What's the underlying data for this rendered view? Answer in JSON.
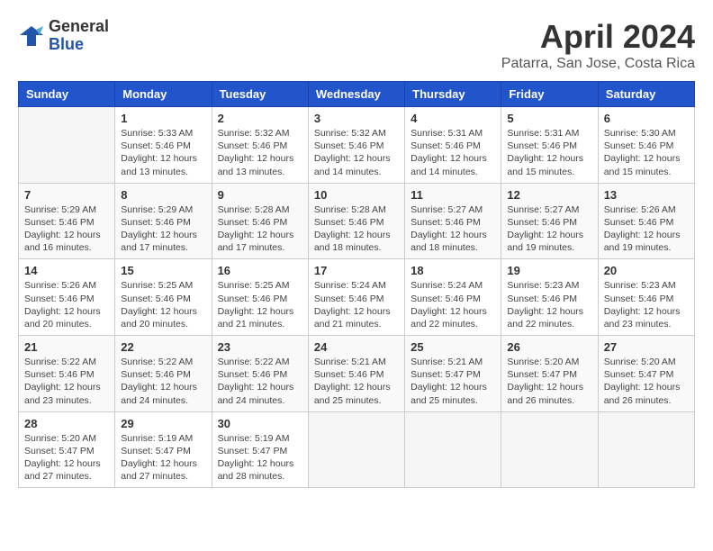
{
  "header": {
    "logo_line1": "General",
    "logo_line2": "Blue",
    "month": "April 2024",
    "location": "Patarra, San Jose, Costa Rica"
  },
  "weekdays": [
    "Sunday",
    "Monday",
    "Tuesday",
    "Wednesday",
    "Thursday",
    "Friday",
    "Saturday"
  ],
  "weeks": [
    [
      {
        "day": "",
        "info": ""
      },
      {
        "day": "1",
        "info": "Sunrise: 5:33 AM\nSunset: 5:46 PM\nDaylight: 12 hours\nand 13 minutes."
      },
      {
        "day": "2",
        "info": "Sunrise: 5:32 AM\nSunset: 5:46 PM\nDaylight: 12 hours\nand 13 minutes."
      },
      {
        "day": "3",
        "info": "Sunrise: 5:32 AM\nSunset: 5:46 PM\nDaylight: 12 hours\nand 14 minutes."
      },
      {
        "day": "4",
        "info": "Sunrise: 5:31 AM\nSunset: 5:46 PM\nDaylight: 12 hours\nand 14 minutes."
      },
      {
        "day": "5",
        "info": "Sunrise: 5:31 AM\nSunset: 5:46 PM\nDaylight: 12 hours\nand 15 minutes."
      },
      {
        "day": "6",
        "info": "Sunrise: 5:30 AM\nSunset: 5:46 PM\nDaylight: 12 hours\nand 15 minutes."
      }
    ],
    [
      {
        "day": "7",
        "info": "Sunrise: 5:29 AM\nSunset: 5:46 PM\nDaylight: 12 hours\nand 16 minutes."
      },
      {
        "day": "8",
        "info": "Sunrise: 5:29 AM\nSunset: 5:46 PM\nDaylight: 12 hours\nand 17 minutes."
      },
      {
        "day": "9",
        "info": "Sunrise: 5:28 AM\nSunset: 5:46 PM\nDaylight: 12 hours\nand 17 minutes."
      },
      {
        "day": "10",
        "info": "Sunrise: 5:28 AM\nSunset: 5:46 PM\nDaylight: 12 hours\nand 18 minutes."
      },
      {
        "day": "11",
        "info": "Sunrise: 5:27 AM\nSunset: 5:46 PM\nDaylight: 12 hours\nand 18 minutes."
      },
      {
        "day": "12",
        "info": "Sunrise: 5:27 AM\nSunset: 5:46 PM\nDaylight: 12 hours\nand 19 minutes."
      },
      {
        "day": "13",
        "info": "Sunrise: 5:26 AM\nSunset: 5:46 PM\nDaylight: 12 hours\nand 19 minutes."
      }
    ],
    [
      {
        "day": "14",
        "info": "Sunrise: 5:26 AM\nSunset: 5:46 PM\nDaylight: 12 hours\nand 20 minutes."
      },
      {
        "day": "15",
        "info": "Sunrise: 5:25 AM\nSunset: 5:46 PM\nDaylight: 12 hours\nand 20 minutes."
      },
      {
        "day": "16",
        "info": "Sunrise: 5:25 AM\nSunset: 5:46 PM\nDaylight: 12 hours\nand 21 minutes."
      },
      {
        "day": "17",
        "info": "Sunrise: 5:24 AM\nSunset: 5:46 PM\nDaylight: 12 hours\nand 21 minutes."
      },
      {
        "day": "18",
        "info": "Sunrise: 5:24 AM\nSunset: 5:46 PM\nDaylight: 12 hours\nand 22 minutes."
      },
      {
        "day": "19",
        "info": "Sunrise: 5:23 AM\nSunset: 5:46 PM\nDaylight: 12 hours\nand 22 minutes."
      },
      {
        "day": "20",
        "info": "Sunrise: 5:23 AM\nSunset: 5:46 PM\nDaylight: 12 hours\nand 23 minutes."
      }
    ],
    [
      {
        "day": "21",
        "info": "Sunrise: 5:22 AM\nSunset: 5:46 PM\nDaylight: 12 hours\nand 23 minutes."
      },
      {
        "day": "22",
        "info": "Sunrise: 5:22 AM\nSunset: 5:46 PM\nDaylight: 12 hours\nand 24 minutes."
      },
      {
        "day": "23",
        "info": "Sunrise: 5:22 AM\nSunset: 5:46 PM\nDaylight: 12 hours\nand 24 minutes."
      },
      {
        "day": "24",
        "info": "Sunrise: 5:21 AM\nSunset: 5:46 PM\nDaylight: 12 hours\nand 25 minutes."
      },
      {
        "day": "25",
        "info": "Sunrise: 5:21 AM\nSunset: 5:47 PM\nDaylight: 12 hours\nand 25 minutes."
      },
      {
        "day": "26",
        "info": "Sunrise: 5:20 AM\nSunset: 5:47 PM\nDaylight: 12 hours\nand 26 minutes."
      },
      {
        "day": "27",
        "info": "Sunrise: 5:20 AM\nSunset: 5:47 PM\nDaylight: 12 hours\nand 26 minutes."
      }
    ],
    [
      {
        "day": "28",
        "info": "Sunrise: 5:20 AM\nSunset: 5:47 PM\nDaylight: 12 hours\nand 27 minutes."
      },
      {
        "day": "29",
        "info": "Sunrise: 5:19 AM\nSunset: 5:47 PM\nDaylight: 12 hours\nand 27 minutes."
      },
      {
        "day": "30",
        "info": "Sunrise: 5:19 AM\nSunset: 5:47 PM\nDaylight: 12 hours\nand 28 minutes."
      },
      {
        "day": "",
        "info": ""
      },
      {
        "day": "",
        "info": ""
      },
      {
        "day": "",
        "info": ""
      },
      {
        "day": "",
        "info": ""
      }
    ]
  ]
}
